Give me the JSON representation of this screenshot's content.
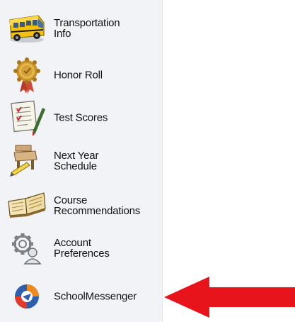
{
  "sidebar": {
    "items": [
      {
        "label": "Transportation\nInfo",
        "icon": "school-bus-icon"
      },
      {
        "label": "Honor Roll",
        "icon": "medal-icon"
      },
      {
        "label": "Test Scores",
        "icon": "test-paper-icon"
      },
      {
        "label": "Next Year\nSchedule",
        "icon": "schedule-desk-icon"
      },
      {
        "label": "Course\nRecommendations",
        "icon": "open-book-icon"
      },
      {
        "label": "Account\nPreferences",
        "icon": "account-gear-icon"
      },
      {
        "label": "SchoolMessenger",
        "icon": "schoolmessenger-logo-icon"
      }
    ]
  },
  "colors": {
    "sidebar_bg": "#f1f3f6",
    "arrow": "#e8141b",
    "bus_yellow": "#f4c20d",
    "sm_blue": "#2e5fae",
    "sm_orange": "#f08a1c"
  }
}
